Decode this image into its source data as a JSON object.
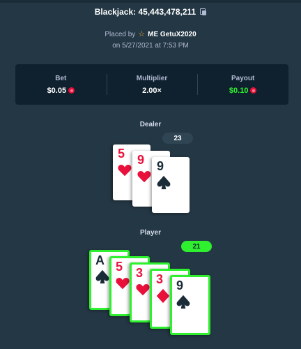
{
  "header": {
    "title": "Blackjack: 45,443,478,211"
  },
  "placed": {
    "prefix": "Placed by",
    "player": "ME GetuX2020",
    "date": "on 5/27/2021 at 7:53 PM"
  },
  "stats": {
    "bet_label": "Bet",
    "bet_value": "$0.05",
    "multiplier_label": "Multiplier",
    "multiplier_value": "2.00×",
    "payout_label": "Payout",
    "payout_value": "$0.10"
  },
  "dealer": {
    "label": "Dealer",
    "score": "23",
    "cards": [
      {
        "rank": "5",
        "suit": "hearts",
        "color": "red"
      },
      {
        "rank": "9",
        "suit": "hearts",
        "color": "red"
      },
      {
        "rank": "9",
        "suit": "spades",
        "color": "black"
      }
    ]
  },
  "player": {
    "label": "Player",
    "score": "21",
    "cards": [
      {
        "rank": "A",
        "suit": "spades",
        "color": "black"
      },
      {
        "rank": "5",
        "suit": "hearts",
        "color": "red"
      },
      {
        "rank": "3",
        "suit": "hearts",
        "color": "red"
      },
      {
        "rank": "3",
        "suit": "diamonds",
        "color": "red"
      },
      {
        "rank": "9",
        "suit": "spades",
        "color": "black"
      }
    ]
  },
  "colors": {
    "background": "#243744",
    "panel": "#0f212e",
    "win_green": "#2ef02e",
    "card_red": "#e9113c",
    "card_black": "#1a2c38"
  }
}
